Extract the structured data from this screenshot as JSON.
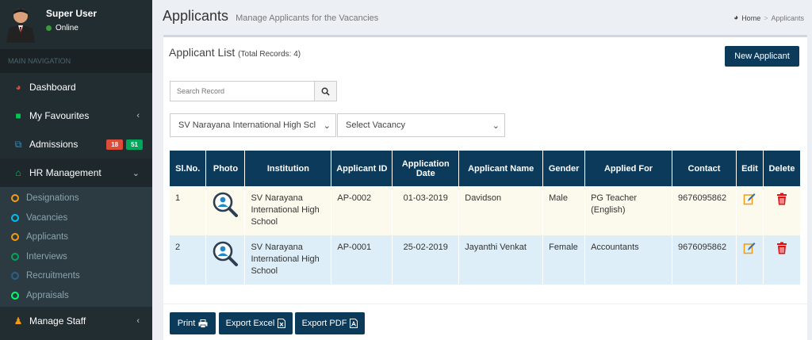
{
  "user": {
    "name": "Super User",
    "status": "Online"
  },
  "sidebar": {
    "header": "MAIN NAVIGATION",
    "items": [
      {
        "label": "Dashboard"
      },
      {
        "label": "My Favourites"
      },
      {
        "label": "Admissions",
        "badges": [
          "18",
          "51"
        ]
      },
      {
        "label": "HR Management"
      },
      {
        "label": "Manage Staff"
      }
    ],
    "submenu": [
      {
        "label": "Designations",
        "color": "#f39c12"
      },
      {
        "label": "Vacancies",
        "color": "#00c0ef"
      },
      {
        "label": "Applicants",
        "color": "#f39c12"
      },
      {
        "label": "Interviews",
        "color": "#00a65a"
      },
      {
        "label": "Recruitments",
        "color": "#3c8dbc"
      },
      {
        "label": "Appraisals",
        "color": "#00ff6a"
      }
    ]
  },
  "page": {
    "title": "Applicants",
    "subtitle": "Manage Applicants for the Vacancies",
    "breadcrumb": {
      "home": "Home",
      "current": "Applicants"
    }
  },
  "list": {
    "title": "Applicant List",
    "total": "(Total Records: 4)",
    "new_button": "New Applicant",
    "search_placeholder": "Search Record",
    "institution_select": "SV Narayana International High Scl",
    "vacancy_select": "Select Vacancy"
  },
  "table": {
    "headers": {
      "slno": "Sl.No.",
      "photo": "Photo",
      "institution": "Institution",
      "applicant_id": "Applicant ID",
      "date": "Application Date",
      "name": "Applicant Name",
      "gender": "Gender",
      "applied_for": "Applied For",
      "contact": "Contact",
      "edit": "Edit",
      "delete": "Delete"
    },
    "rows": [
      {
        "slno": "1",
        "institution": "SV Narayana International High School",
        "id": "AP-0002",
        "date": "01-03-2019",
        "name": "Davidson",
        "gender": "Male",
        "applied_for": "PG Teacher (English)",
        "contact": "9676095862"
      },
      {
        "slno": "2",
        "institution": "SV Narayana International High School",
        "id": "AP-0001",
        "date": "25-02-2019",
        "name": "Jayanthi Venkat",
        "gender": "Female",
        "applied_for": "Accountants",
        "contact": "9676095862"
      }
    ]
  },
  "footer": {
    "print": "Print",
    "excel": "Export Excel",
    "pdf": "Export PDF"
  },
  "colors": {
    "primary": "#0b3a5a",
    "sidebar": "#222d32",
    "badge_red": "#dd4b39",
    "badge_green": "#00a65a",
    "delete": "#dd1111",
    "edit": "#f39c12"
  }
}
